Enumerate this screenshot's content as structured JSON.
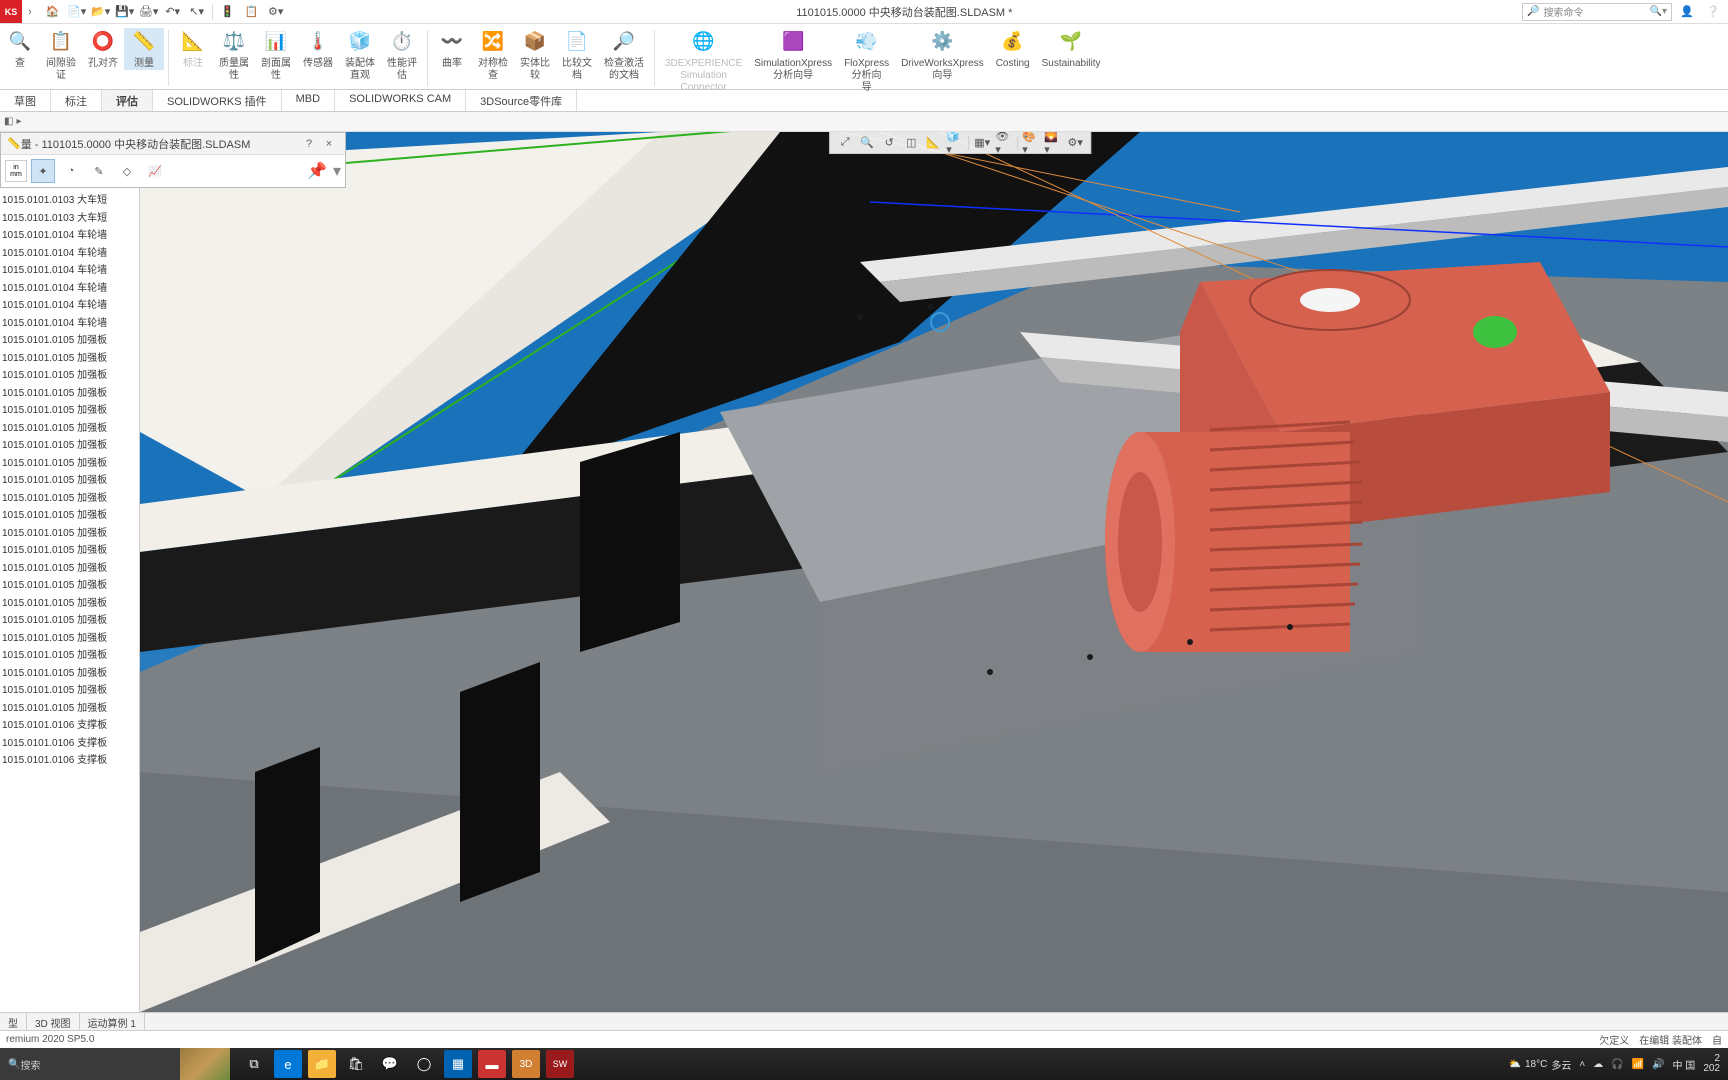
{
  "app": {
    "brand_fragment": "KS",
    "title": "1101015.0000 中央移动台装配图.SLDASM *"
  },
  "qat": [
    "home",
    "new",
    "open",
    "save",
    "print",
    "undo",
    "select",
    "macro",
    "rebuild",
    "settings"
  ],
  "search": {
    "placeholder": "搜索命令"
  },
  "ribbon": [
    {
      "label": "查",
      "enabled": true
    },
    {
      "label": "间隙验\n证",
      "enabled": true
    },
    {
      "label": "孔对齐",
      "enabled": true
    },
    {
      "label": "测量",
      "enabled": true,
      "selected": true
    },
    {
      "label": "标注",
      "enabled": false
    },
    {
      "label": "质量属\n性",
      "enabled": true
    },
    {
      "label": "剖面属\n性",
      "enabled": true
    },
    {
      "label": "传感器",
      "enabled": true
    },
    {
      "label": "装配体\n直观",
      "enabled": true
    },
    {
      "label": "性能评\n估",
      "enabled": true
    },
    {
      "label": "曲率",
      "enabled": true
    },
    {
      "label": "对称检\n查",
      "enabled": true
    },
    {
      "label": "实体比\n较",
      "enabled": true
    },
    {
      "label": "比较文\n档",
      "enabled": true
    },
    {
      "label": "检查激活\n的文档",
      "enabled": true
    },
    {
      "label": "3DEXPERIENCE\nSimulation\nConnector",
      "enabled": false
    },
    {
      "label": "SimulationXpress\n分析向导",
      "enabled": true
    },
    {
      "label": "FloXpress\n分析向\n导",
      "enabled": true
    },
    {
      "label": "DriveWorksXpress\n向导",
      "enabled": true
    },
    {
      "label": "Costing",
      "enabled": true
    },
    {
      "label": "Sustainability",
      "enabled": true
    }
  ],
  "ribbon_icons": [
    "🔍",
    "📋",
    "⭕",
    "📏",
    "📐",
    "⚖️",
    "📊",
    "🌡️",
    "🧊",
    "⏱️",
    "〰️",
    "🔀",
    "📦",
    "📄",
    "🔎",
    "🌐",
    "🟪",
    "💨",
    "⚙️",
    "💰",
    "🌱"
  ],
  "tabs": [
    "草图",
    "标注",
    "评估",
    "SOLIDWORKS 插件",
    "MBD",
    "SOLIDWORKS CAM",
    "3DSource零件库"
  ],
  "active_tab": 2,
  "measure": {
    "title": "量 - 1101015.0000 中央移动台装配图.SLDASM",
    "unit_top": "in",
    "unit_bottom": "mm"
  },
  "tree": [
    "1015.0101.0103 大车短",
    "1015.0101.0103 大车短",
    "1015.0101.0104 车轮墙",
    "1015.0101.0104 车轮墙",
    "1015.0101.0104 车轮墙",
    "1015.0101.0104 车轮墙",
    "1015.0101.0104 车轮墙",
    "1015.0101.0104 车轮墙",
    "1015.0101.0105 加强板",
    "1015.0101.0105 加强板",
    "1015.0101.0105 加强板",
    "1015.0101.0105 加强板",
    "1015.0101.0105 加强板",
    "1015.0101.0105 加强板",
    "1015.0101.0105 加强板",
    "1015.0101.0105 加强板",
    "1015.0101.0105 加强板",
    "1015.0101.0105 加强板",
    "1015.0101.0105 加强板",
    "1015.0101.0105 加强板",
    "1015.0101.0105 加强板",
    "1015.0101.0105 加强板",
    "1015.0101.0105 加强板",
    "1015.0101.0105 加强板",
    "1015.0101.0105 加强板",
    "1015.0101.0105 加强板",
    "1015.0101.0105 加强板",
    "1015.0101.0105 加强板",
    "1015.0101.0105 加强板",
    "1015.0101.0105 加强板",
    "1015.0101.0106 支撑板",
    "1015.0101.0106 支撑板",
    "1015.0101.0106 支撑板"
  ],
  "bottom_tabs": [
    "型",
    "3D 视图",
    "运动算例 1"
  ],
  "status": {
    "left": "remium 2020 SP5.0",
    "right1": "欠定义",
    "right2": "在编辑 装配体",
    "right3": "自"
  },
  "taskbar": {
    "search_hint": "搜索",
    "weather_temp": "18°C",
    "weather_text": "多云",
    "ime": "中 国",
    "time": "2",
    "date": "202"
  }
}
